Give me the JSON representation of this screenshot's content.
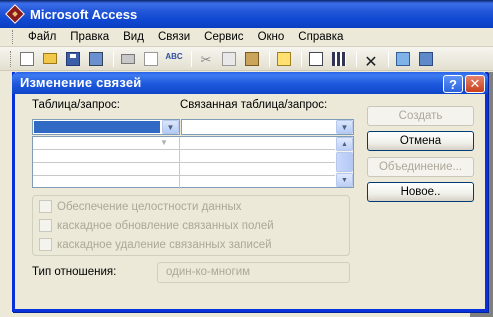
{
  "app": {
    "title": "Microsoft Access"
  },
  "menubar": [
    {
      "label": "Файл",
      "id": "file"
    },
    {
      "label": "Правка",
      "id": "edit"
    },
    {
      "label": "Вид",
      "id": "view"
    },
    {
      "label": "Связи",
      "id": "relations"
    },
    {
      "label": "Сервис",
      "id": "tools"
    },
    {
      "label": "Окно",
      "id": "window"
    },
    {
      "label": "Справка",
      "id": "help"
    }
  ],
  "toolbar": {
    "icons": [
      "new-icon",
      "open-icon",
      "save-icon",
      "build-icon",
      "print-icon",
      "print-preview-icon",
      "spelling-icon",
      "cut-icon",
      "copy-icon",
      "paste-icon",
      "show-table-icon",
      "direct-relationships-icon",
      "all-relationships-icon",
      "delete-icon",
      "database-window-icon",
      "new-object-icon"
    ],
    "spelling_text": "ABC"
  },
  "dialog": {
    "title": "Изменение связей",
    "help_label": "?",
    "close_label": "✕",
    "table_label": "Таблица/запрос:",
    "related_table_label": "Связанная таблица/запрос:",
    "table_value": "",
    "related_table_value": "",
    "buttons": {
      "create": "Создать",
      "cancel": "Отмена",
      "join": "Объединение...",
      "new": "Новое.."
    },
    "checkboxes": {
      "integrity": "Обеспечение целостности данных",
      "cascade_update": "каскадное обновление связанных полей",
      "cascade_delete": "каскадное удаление связанных записей"
    },
    "relation_type_label": "Тип отношения:",
    "relation_type_value": "один-ко-многим"
  },
  "colors": {
    "titlebar": "#0f48d2",
    "selection": "#316ac5",
    "dialog_bg": "#ece9d8",
    "disabled_text": "#aca899"
  }
}
